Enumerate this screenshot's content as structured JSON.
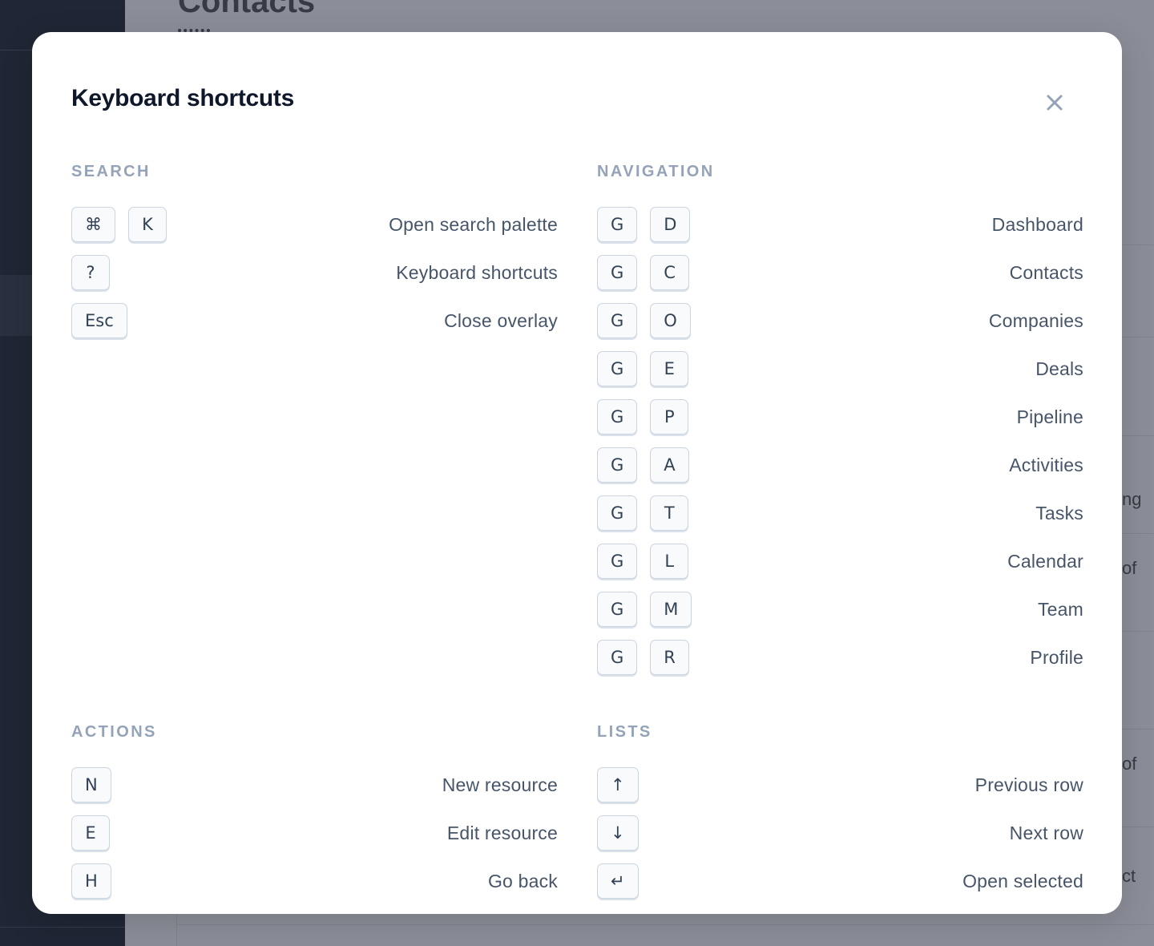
{
  "background": {
    "page_title": "Contacts",
    "fragments": [
      "ng",
      "of",
      "of",
      "ct"
    ]
  },
  "modal": {
    "title": "Keyboard shortcuts",
    "close_icon": "close-icon",
    "sections": {
      "search": {
        "label": "SEARCH",
        "rows": [
          {
            "keys": [
              "⌘",
              "K"
            ],
            "desc": "Open search palette"
          },
          {
            "keys": [
              "?"
            ],
            "desc": "Keyboard shortcuts"
          },
          {
            "keys": [
              "Esc"
            ],
            "desc": "Close overlay"
          }
        ]
      },
      "navigation": {
        "label": "NAVIGATION",
        "rows": [
          {
            "keys": [
              "G",
              "D"
            ],
            "desc": "Dashboard"
          },
          {
            "keys": [
              "G",
              "C"
            ],
            "desc": "Contacts"
          },
          {
            "keys": [
              "G",
              "O"
            ],
            "desc": "Companies"
          },
          {
            "keys": [
              "G",
              "E"
            ],
            "desc": "Deals"
          },
          {
            "keys": [
              "G",
              "P"
            ],
            "desc": "Pipeline"
          },
          {
            "keys": [
              "G",
              "A"
            ],
            "desc": "Activities"
          },
          {
            "keys": [
              "G",
              "T"
            ],
            "desc": "Tasks"
          },
          {
            "keys": [
              "G",
              "L"
            ],
            "desc": "Calendar"
          },
          {
            "keys": [
              "G",
              "M"
            ],
            "desc": "Team"
          },
          {
            "keys": [
              "G",
              "R"
            ],
            "desc": "Profile"
          }
        ]
      },
      "actions": {
        "label": "ACTIONS",
        "rows": [
          {
            "keys": [
              "N"
            ],
            "desc": "New resource"
          },
          {
            "keys": [
              "E"
            ],
            "desc": "Edit resource"
          },
          {
            "keys": [
              "H"
            ],
            "desc": "Go back"
          }
        ]
      },
      "lists": {
        "label": "LISTS",
        "rows": [
          {
            "keys": [
              "↑"
            ],
            "desc": "Previous row"
          },
          {
            "keys": [
              "↓"
            ],
            "desc": "Next row"
          },
          {
            "keys": [
              "↵"
            ],
            "desc": "Open selected"
          }
        ]
      }
    }
  },
  "colors": {
    "modal_bg": "#ffffff",
    "title": "#0f172a",
    "section_label": "#94a3b8",
    "description": "#475569",
    "key_border": "#cbd5e1",
    "backdrop": "#8e919b",
    "sidebar": "#111827"
  }
}
